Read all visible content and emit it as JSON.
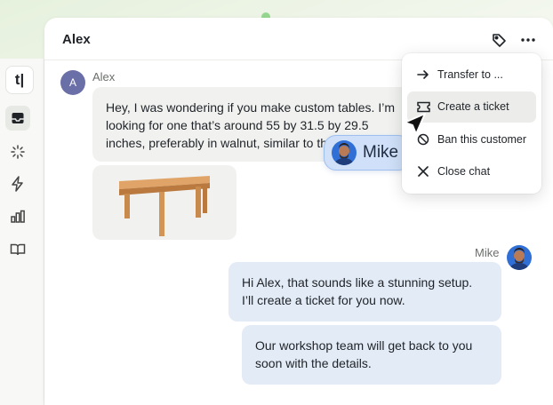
{
  "rail": {
    "logo_text": "t|",
    "icons": [
      "inbox-icon",
      "sparkle-icon",
      "bolt-icon",
      "reports-icon",
      "book-icon"
    ]
  },
  "header": {
    "title": "Alex",
    "icons": [
      "tag-icon",
      "more-icon"
    ]
  },
  "conversation": {
    "alex": {
      "initial": "A",
      "name": "Alex",
      "message_lines": [
        "Hey, I was wondering if you make custom tables. I’m",
        "looking for one that’s around 55 by 31.5 by 29.5",
        "inches, preferably in walnut, similar to this"
      ]
    },
    "mike": {
      "name": "Mike",
      "messages": [
        {
          "lines": [
            "Hi Alex, that sounds like a stunning setup.",
            "I’ll create a ticket for you now."
          ]
        },
        {
          "lines": [
            "Our workshop team will get back to you",
            "soon with the details."
          ]
        }
      ]
    }
  },
  "menu": {
    "items": [
      {
        "label": "Transfer to ...",
        "icon": "arrow-right-icon",
        "highlighted": false
      },
      {
        "label": "Create a ticket",
        "icon": "ticket-icon",
        "highlighted": true
      },
      {
        "label": "Ban this customer",
        "icon": "ban-icon",
        "highlighted": false
      },
      {
        "label": "Close chat",
        "icon": "close-icon",
        "highlighted": false
      }
    ]
  },
  "tag": {
    "label": "Mike"
  },
  "colors": {
    "alex_bubble": "#f1f2f0",
    "mike_bubble": "#e3ebf6",
    "alex_avatar": "#6b6fa8",
    "tag_bg": "#cfe0f8"
  }
}
